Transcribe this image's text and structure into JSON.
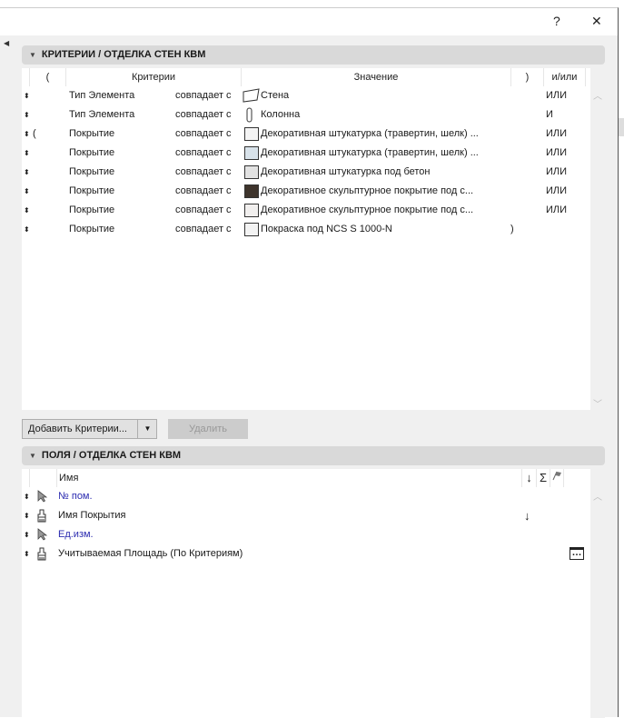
{
  "window": {
    "help": "?",
    "close": "✕"
  },
  "criteria": {
    "title": "КРИТЕРИИ /  ОТДЕЛКА СТЕН КВМ",
    "headers": {
      "open": "(",
      "criteria": "Критерии",
      "value": "Значение",
      "close": ")",
      "andor": "и/или"
    },
    "rows": [
      {
        "open": "",
        "field": "Тип Элемента",
        "op": "совпадает с",
        "icon": "wall-icon",
        "value": "Стена",
        "close": "",
        "andor": "ИЛИ"
      },
      {
        "open": "",
        "field": "Тип Элемента",
        "op": "совпадает с",
        "icon": "column-icon",
        "value": "Колонна",
        "close": "",
        "andor": "И"
      },
      {
        "open": "(",
        "field": "Покрытие",
        "op": "совпадает с",
        "swatch": "#f4f4f4",
        "value": "Декоративная штукатурка (травертин, шелк) ...",
        "close": "",
        "andor": "ИЛИ"
      },
      {
        "open": "",
        "field": "Покрытие",
        "op": "совпадает с",
        "swatch": "#d8e2ea",
        "value": "Декоративная штукатурка (травертин, шелк) ...",
        "close": "",
        "andor": "ИЛИ"
      },
      {
        "open": "",
        "field": "Покрытие",
        "op": "совпадает с",
        "swatch": "#e2e2e2",
        "value": "Декоративная штукатурка под бетон",
        "close": "",
        "andor": "ИЛИ"
      },
      {
        "open": "",
        "field": "Покрытие",
        "op": "совпадает с",
        "swatch": "#3e342c",
        "value": "Декоративное скульптурное покрытие под с...",
        "close": "",
        "andor": "ИЛИ"
      },
      {
        "open": "",
        "field": "Покрытие",
        "op": "совпадает с",
        "swatch": "#f1efee",
        "value": "Декоративное скульптурное покрытие под с...",
        "close": "",
        "andor": "ИЛИ"
      },
      {
        "open": "",
        "field": "Покрытие",
        "op": "совпадает с",
        "swatch": "#f3f3f3",
        "value": "Покраска под NCS S 1000-N",
        "close": ")",
        "andor": ""
      }
    ],
    "add_button": "Добавить Критерии...",
    "delete_button": "Удалить"
  },
  "fields": {
    "title": "ПОЛЯ /  ОТДЕЛКА СТЕН КВМ",
    "headers": {
      "name": "Имя",
      "sort": "↓",
      "sum": "Σ",
      "flag": "flag-icon"
    },
    "rows": [
      {
        "icon": "cursor-icon",
        "name": "№ пом.",
        "color": "blue",
        "sort": "",
        "extra": ""
      },
      {
        "icon": "brush-icon",
        "name": "Имя Покрытия",
        "color": "",
        "sort": "↓",
        "extra": ""
      },
      {
        "icon": "cursor-icon",
        "name": "Ед.изм.",
        "color": "blue",
        "sort": "",
        "extra": ""
      },
      {
        "icon": "brush-icon",
        "name": "Учитываемая Площадь (По Критериям)",
        "color": "",
        "sort": "",
        "extra": "…"
      }
    ]
  }
}
